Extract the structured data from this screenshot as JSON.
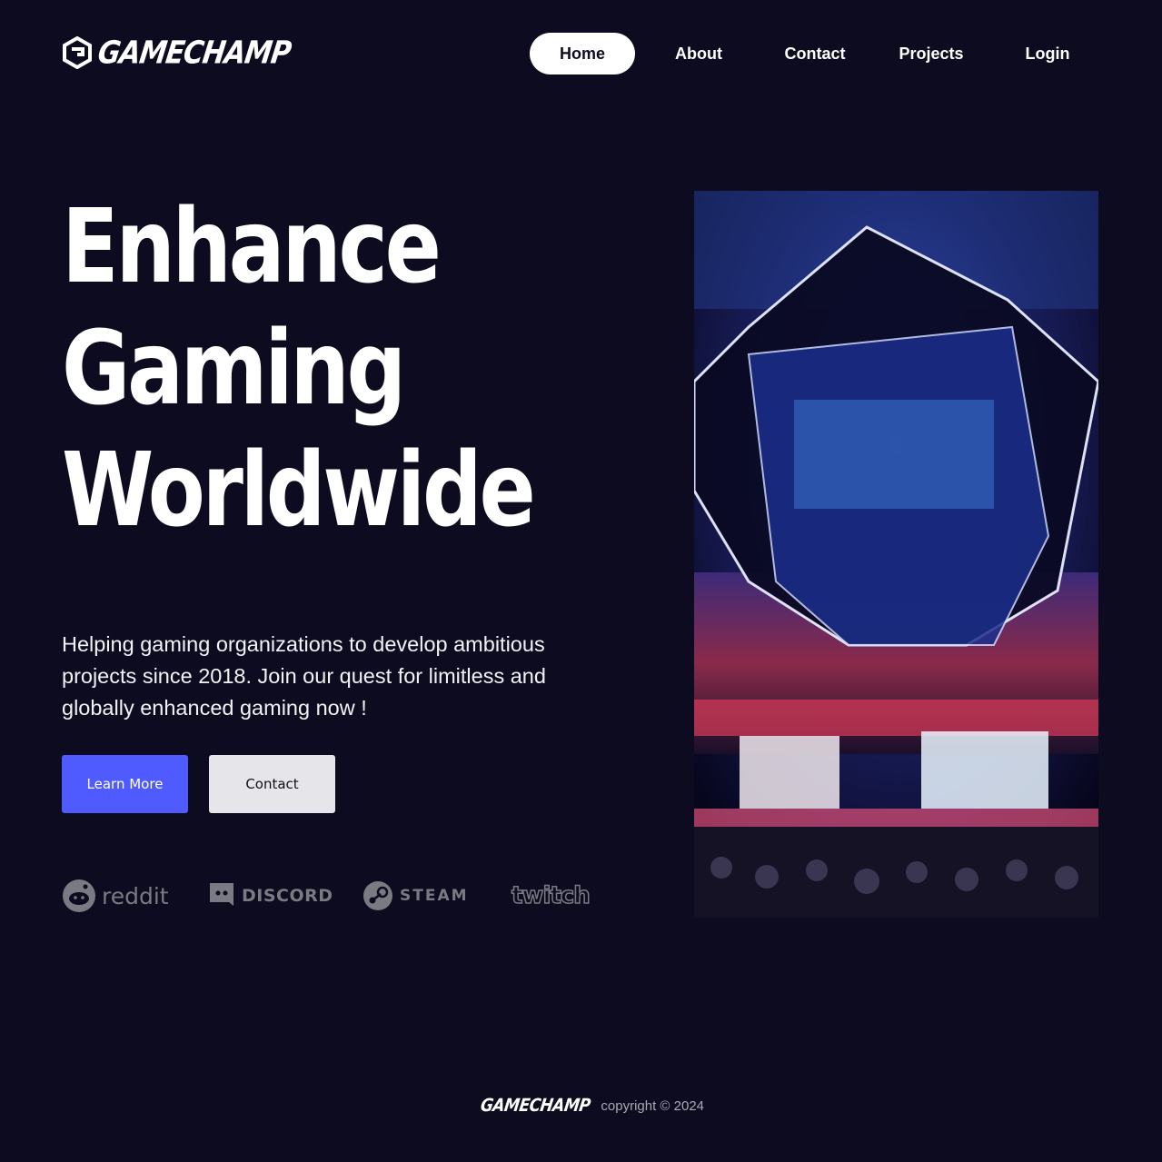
{
  "brand": {
    "name": "GAMECHAMP"
  },
  "nav": {
    "items": [
      {
        "label": "Home",
        "active": true
      },
      {
        "label": "About"
      },
      {
        "label": "Contact"
      },
      {
        "label": "Projects"
      },
      {
        "label": "Login"
      }
    ]
  },
  "hero": {
    "title_lines": [
      "Enhance",
      "Gaming",
      "Worldwide"
    ],
    "tagline": "Helping gaming organizations to develop ambitious projects since 2018. Join our quest for limitless and globally enhanced gaming now !",
    "primary_button": "Learn More",
    "secondary_button": "Contact",
    "image_icon": "esports-arena-image"
  },
  "partners": [
    {
      "name": "reddit",
      "icon": "reddit-icon"
    },
    {
      "name": "DISCORD",
      "icon": "discord-icon"
    },
    {
      "name": "STEAM",
      "icon": "steam-icon"
    },
    {
      "name": "twitch",
      "icon": "twitch-icon"
    }
  ],
  "footer": {
    "brand": "GAMECHAMP",
    "copyright": "copyright © 2024"
  },
  "colors": {
    "background": "#0d0b20",
    "accent": "#4f5bff",
    "muted": "#7a7a82"
  }
}
